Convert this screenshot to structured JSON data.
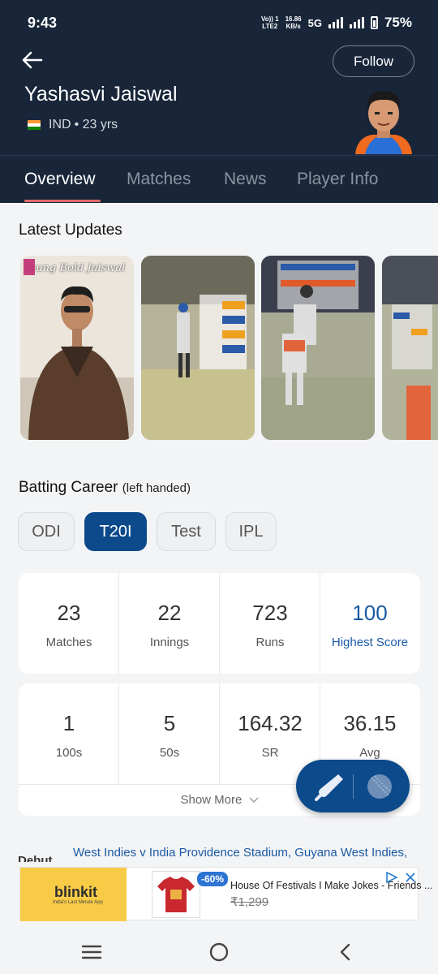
{
  "status_bar": {
    "time": "9:43",
    "network_top": "Vo)) 1",
    "network_bottom": "LTE2",
    "speed_top": "16.86",
    "speed_bottom": "KB/s",
    "network_type": "5G",
    "battery": "75%"
  },
  "header": {
    "follow_label": "Follow",
    "player_name": "Yashasvi Jaiswal",
    "country": "IND",
    "age": "• 23 yrs"
  },
  "tabs": [
    {
      "label": "Overview",
      "active": true
    },
    {
      "label": "Matches",
      "active": false
    },
    {
      "label": "News",
      "active": false
    },
    {
      "label": "Player Info",
      "active": false
    }
  ],
  "latest_updates": {
    "title": "Latest Updates",
    "card1_overlay": "Young Bold Jaiswal"
  },
  "batting": {
    "title": "Batting Career",
    "subtitle": "(left handed)",
    "formats": [
      "ODI",
      "T20I",
      "Test",
      "IPL"
    ],
    "selected_format": "T20I",
    "primary_stats": [
      {
        "value": "23",
        "label": "Matches"
      },
      {
        "value": "22",
        "label": "Innings"
      },
      {
        "value": "723",
        "label": "Runs"
      },
      {
        "value": "100",
        "label": "Highest Score"
      }
    ],
    "secondary_stats": [
      {
        "value": "1",
        "label": "100s"
      },
      {
        "value": "5",
        "label": "50s"
      },
      {
        "value": "164.32",
        "label": "SR"
      },
      {
        "value": "36.15",
        "label": "Avg"
      }
    ],
    "show_more": "Show More"
  },
  "debut": {
    "label": "Debut",
    "text": "West Indies v India Providence Stadium, Guyana West Indies,"
  },
  "ad": {
    "brand": "blinkit",
    "brand_tagline": "India's Last Minute App",
    "discount": "-60%",
    "title": "House Of Festivals I Make Jokes - Friends ...",
    "price": "₹1,299"
  },
  "colors": {
    "header_bg": "#19263a",
    "accent_blue": "#0c4a8c",
    "tab_underline": "#e06a6a",
    "highlight_text": "#1a5aa3"
  }
}
